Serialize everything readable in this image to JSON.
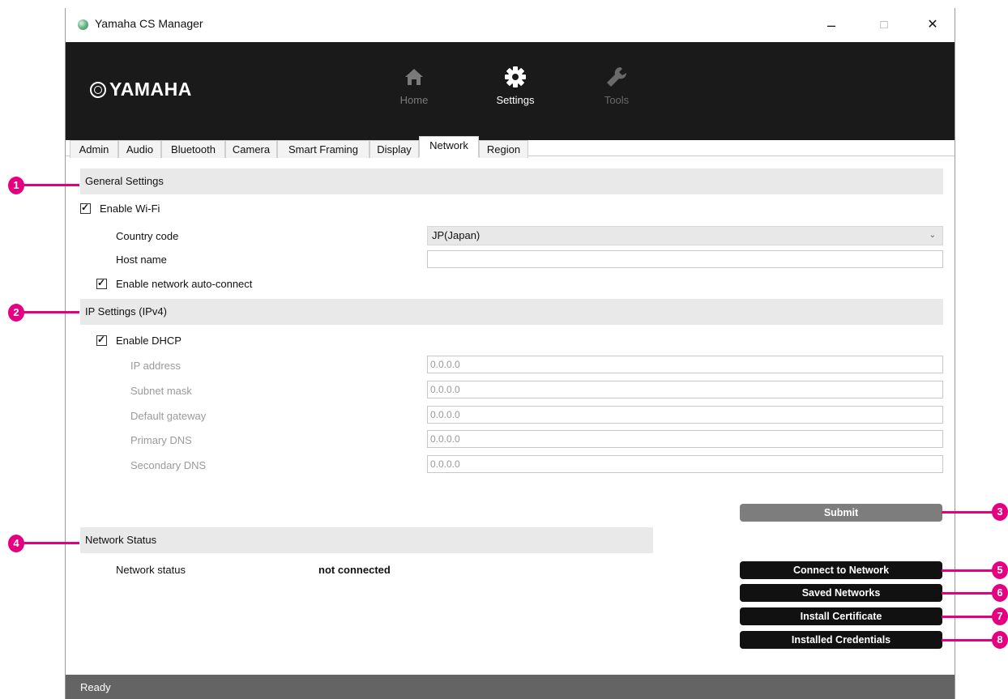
{
  "window": {
    "title": "Yamaha CS Manager"
  },
  "window_controls": {
    "minimize": "–",
    "maximize": "□",
    "close": "✕"
  },
  "header": {
    "logo_text": "YAMAHA",
    "nav": [
      {
        "label": "Home",
        "icon": "home-icon",
        "active": false
      },
      {
        "label": "Settings",
        "icon": "gear-icon",
        "active": true
      },
      {
        "label": "Tools",
        "icon": "wrench-icon",
        "active": false
      }
    ]
  },
  "tabs": [
    "Admin",
    "Audio",
    "Bluetooth",
    "Camera",
    "Smart Framing",
    "Display",
    "Network",
    "Region"
  ],
  "active_tab": "Network",
  "general_settings": {
    "title": "General Settings",
    "enable_wifi_label": "Enable Wi-Fi",
    "enable_wifi_checked": true,
    "country_code_label": "Country code",
    "country_code_value": "JP(Japan)",
    "host_name_label": "Host name",
    "host_name_value": "",
    "auto_connect_label": "Enable network auto-connect",
    "auto_connect_checked": true
  },
  "ip_settings": {
    "title": "IP Settings (IPv4)",
    "enable_dhcp_label": "Enable DHCP",
    "enable_dhcp_checked": true,
    "fields": [
      {
        "label": "IP address",
        "value": "0.0.0.0"
      },
      {
        "label": "Subnet mask",
        "value": "0.0.0.0"
      },
      {
        "label": "Default gateway",
        "value": "0.0.0.0"
      },
      {
        "label": "Primary DNS",
        "value": "0.0.0.0"
      },
      {
        "label": "Secondary DNS",
        "value": "0.0.0.0"
      }
    ]
  },
  "buttons": {
    "submit": "Submit",
    "connect": "Connect to Network",
    "saved": "Saved Networks",
    "install_cert": "Install Certificate",
    "installed_creds": "Installed Credentials"
  },
  "network_status": {
    "title": "Network Status",
    "label": "Network status",
    "value": "not connected"
  },
  "statusbar": {
    "text": "Ready"
  },
  "callouts": [
    "1",
    "2",
    "3",
    "4",
    "5",
    "6",
    "7",
    "8"
  ],
  "colors": {
    "callout": "#e4007f",
    "header_bg": "#1a1a1a",
    "statusbar_bg": "#646464"
  }
}
